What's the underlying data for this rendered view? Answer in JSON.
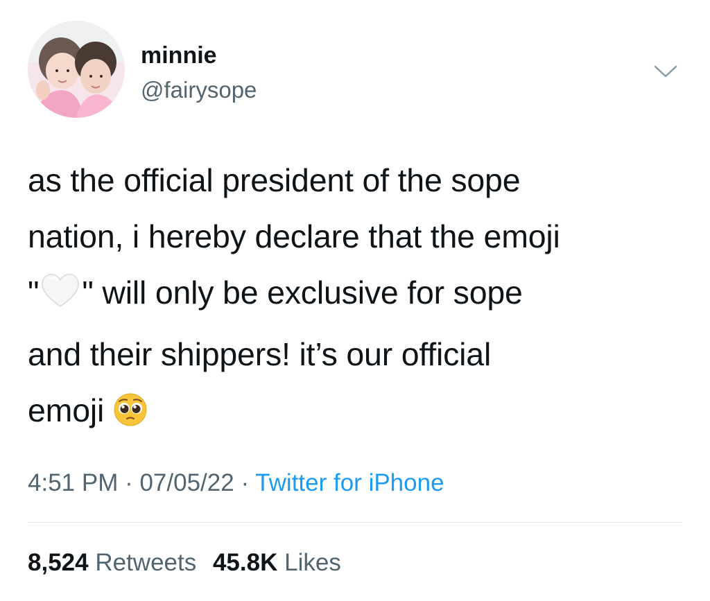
{
  "user": {
    "display_name": "minnie",
    "handle": "@fairysope",
    "avatar_icon": "profile-photo-avatar"
  },
  "menu": {
    "icon": "chevron-down-icon"
  },
  "tweet": {
    "line1": "as the official president of the sope",
    "line2": "nation, i hereby declare that the emoji",
    "line3_quote_open": "\"",
    "line3_quote_close": "\" will only be exclusive for sope",
    "line4": "and their shippers! it’s our official",
    "line5": "emoji",
    "emoji_heart": "white-heart-emoji",
    "emoji_face": "pleading-face-emoji"
  },
  "meta": {
    "time": "4:51 PM",
    "separator1": " · ",
    "date": "07/05/22",
    "separator2": " · ",
    "source": "Twitter for iPhone"
  },
  "stats": {
    "retweets_count": "8,524",
    "retweets_label": "Retweets",
    "likes_count": "45.8K",
    "likes_label": "Likes"
  },
  "colors": {
    "text_primary": "#0f1419",
    "text_secondary": "#536471",
    "link": "#1d9bf0",
    "divider": "#e1e8ed"
  }
}
